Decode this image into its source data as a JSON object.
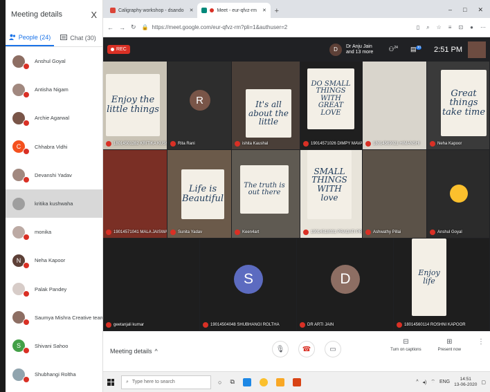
{
  "panel": {
    "title": "Meeting details",
    "close": "X",
    "tabs": [
      {
        "label": "People (24)"
      },
      {
        "label": "Chat (30)"
      }
    ],
    "people": [
      {
        "name": "Anshul Goyal",
        "color": "#8d6e63",
        "initial": ""
      },
      {
        "name": "Antisha Nigam",
        "color": "#a1887f",
        "initial": ""
      },
      {
        "name": "Archie Agarwal",
        "color": "#795548",
        "initial": ""
      },
      {
        "name": "Chhabra Vidhi",
        "color": "#f4511e",
        "initial": "C"
      },
      {
        "name": "Devanshi Yadav",
        "color": "#a1887f",
        "initial": ""
      },
      {
        "name": "kritika kushwaha",
        "color": "#9e9e9e",
        "initial": ""
      },
      {
        "name": "monika",
        "color": "#bcaaa4",
        "initial": ""
      },
      {
        "name": "Neha Kapoor",
        "color": "#5d4037",
        "initial": "N"
      },
      {
        "name": "Palak Pandey",
        "color": "#d7ccc8",
        "initial": ""
      },
      {
        "name": "Saumya Mishra Creative team",
        "color": "#8d6e63",
        "initial": ""
      },
      {
        "name": "Shivani Sahoo",
        "color": "#43a047",
        "initial": "S"
      },
      {
        "name": "Shubhangi Roltha",
        "color": "#90a4ae",
        "initial": ""
      }
    ]
  },
  "browser": {
    "tabs": [
      {
        "label": "Caligraphy workshop - dsando",
        "icon_color": "#db4437"
      },
      {
        "label": "Meet - eur-qfvz-rm",
        "icon_color": "#00897b"
      }
    ],
    "new_tab": "+",
    "window_controls": [
      "–",
      "□",
      "✕"
    ],
    "url_host": "https://meet.google.com",
    "url_path": "/eur-qfvz-rm?pli=1&authuser=2"
  },
  "meet": {
    "rec_label": "REC",
    "presenter_initial": "D",
    "presenter_line1": "Dr Anju Jain",
    "presenter_line2": "and 13 more",
    "people_count": "24",
    "chat_count": "30",
    "time": "2:51 PM",
    "tiles": [
      {
        "label": "18014501282 KRITIKA KUSHW..."
      },
      {
        "label": "Rita Rani",
        "initial": "R"
      },
      {
        "label": "ishita Kaushal"
      },
      {
        "label": "19014571026 DIMPY MAVAR"
      },
      {
        "label": "18014569021 HIMANSHI"
      },
      {
        "label": "Neha Kapoor"
      },
      {
        "label": "19014571041 MALA JAISWAL"
      },
      {
        "label": "Sunita Yadav"
      },
      {
        "label": "Keen4art"
      },
      {
        "label": "19014518031 PRAGATI PRERNA"
      },
      {
        "label": "Ashwathy Pillai"
      },
      {
        "label": "Anshul Goyal"
      },
      {
        "label": "geetanjali kumar"
      },
      {
        "label": "19014504048 SHUBHANGI ROLTHA",
        "initial": "S"
      },
      {
        "label": "DR ARTI JAIN",
        "initial": "D"
      },
      {
        "label": "18014560114 ROSHNI KAPOOR"
      }
    ],
    "paper_texts": {
      "t1": "Enjoy the little things",
      "t3": "It's all about the little",
      "t4": "DO SMALL THINGS WITH GREAT LOVE",
      "t6": "Great things take time",
      "t8": "Life is Beautiful",
      "t9": "The truth is out there",
      "t10": "SMALL THINGS WITH love",
      "t16": "Enjoy life"
    }
  },
  "bottom": {
    "meeting_details": "Meeting details",
    "captions": "Turn on captions",
    "present": "Present now"
  },
  "taskbar": {
    "search_placeholder": "Type here to search",
    "lang": "ENG",
    "time": "14:51",
    "date": "13-06-2020"
  }
}
